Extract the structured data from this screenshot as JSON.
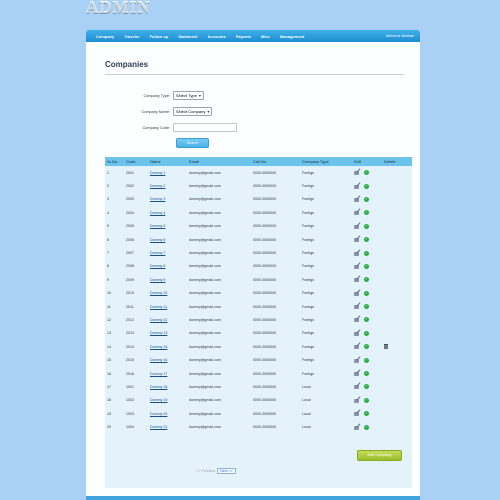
{
  "app": {
    "logo": "ADMIN"
  },
  "nav": {
    "items": [
      "Company",
      "Traveler",
      "Follow up",
      "Statement",
      "Accounts",
      "Reports",
      "Misc",
      "Management"
    ],
    "welcome": "Welcome Bedhan"
  },
  "page": {
    "title": "Companies"
  },
  "form": {
    "company_type_label": "Company Type:",
    "company_type_value": "Select Type",
    "company_name_label": "Company Name:",
    "company_name_value": "Select Company",
    "company_code_label": "Company Code:",
    "company_code_value": "",
    "search_label": "Search"
  },
  "table": {
    "headers": [
      "Sr.No.",
      "Code",
      "Name",
      "Email",
      "Cell No.",
      "Company Type",
      "Edit",
      "Delete"
    ],
    "rows": [
      {
        "sr": "1",
        "code": "2001",
        "name": "Dummy 1",
        "email": "dummy@gmail.com",
        "cell": "0000-0000000",
        "type": "Foreign",
        "delete": false
      },
      {
        "sr": "2",
        "code": "2002",
        "name": "Dummy 2",
        "email": "dummy@gmail.com",
        "cell": "0000-0000000",
        "type": "Foreign",
        "delete": false
      },
      {
        "sr": "3",
        "code": "2003",
        "name": "Dummy 3",
        "email": "dummy@gmail.com",
        "cell": "0000-0000000",
        "type": "Foreign",
        "delete": false
      },
      {
        "sr": "4",
        "code": "2004",
        "name": "Dummy 4",
        "email": "dummy@gmail.com",
        "cell": "0000-0000000",
        "type": "Foreign",
        "delete": false
      },
      {
        "sr": "5",
        "code": "2005",
        "name": "Dummy 5",
        "email": "dummy@gmail.com",
        "cell": "0000-0000000",
        "type": "Foreign",
        "delete": false
      },
      {
        "sr": "6",
        "code": "2006",
        "name": "Dummy 6",
        "email": "dummy@gmail.com",
        "cell": "0000-0000000",
        "type": "Foreign",
        "delete": false
      },
      {
        "sr": "7",
        "code": "2007",
        "name": "Dummy 7",
        "email": "dummy@gmail.com",
        "cell": "0000-0000000",
        "type": "Foreign",
        "delete": false
      },
      {
        "sr": "8",
        "code": "2008",
        "name": "Dummy 8",
        "email": "dummy@gmail.com",
        "cell": "0000-0000000",
        "type": "Foreign",
        "delete": false
      },
      {
        "sr": "9",
        "code": "2009",
        "name": "Dummy 9",
        "email": "dummy@gmail.com",
        "cell": "0000-0000000",
        "type": "Foreign",
        "delete": false
      },
      {
        "sr": "10",
        "code": "2010",
        "name": "Dummy 10",
        "email": "dummy@gmail.com",
        "cell": "0000-0000000",
        "type": "Foreign",
        "delete": false
      },
      {
        "sr": "11",
        "code": "2011",
        "name": "Dummy 11",
        "email": "dummy@gmail.com",
        "cell": "0000-0000000",
        "type": "Foreign",
        "delete": false
      },
      {
        "sr": "12",
        "code": "2012",
        "name": "Dummy 12",
        "email": "dummy@gmail.com",
        "cell": "0000-0000000",
        "type": "Foreign",
        "delete": false
      },
      {
        "sr": "13",
        "code": "2013",
        "name": "Dummy 13",
        "email": "dummy@gmail.com",
        "cell": "0000-0000000",
        "type": "Foreign",
        "delete": false
      },
      {
        "sr": "14",
        "code": "2014",
        "name": "Dummy 15",
        "email": "dummy@gmail.com",
        "cell": "0000-0000000",
        "type": "Foreign",
        "delete": true
      },
      {
        "sr": "15",
        "code": "2015",
        "name": "Dummy 16",
        "email": "dummy@gmail.com",
        "cell": "0000-0000000",
        "type": "Foreign",
        "delete": false
      },
      {
        "sr": "16",
        "code": "2016",
        "name": "Dummy 17",
        "email": "dummy@gmail.com",
        "cell": "0000-0000000",
        "type": "Foreign",
        "delete": false
      },
      {
        "sr": "17",
        "code": "1001",
        "name": "Dummy 18",
        "email": "dummy@gmail.com",
        "cell": "0000-0000000",
        "type": "Local",
        "delete": false
      },
      {
        "sr": "18",
        "code": "1002",
        "name": "Dummy 19",
        "email": "dummy@gmail.com",
        "cell": "0000-0000000",
        "type": "Local",
        "delete": false
      },
      {
        "sr": "19",
        "code": "1003",
        "name": "Dummy 20",
        "email": "dummy@gmail.com",
        "cell": "0000-0000000",
        "type": "Local",
        "delete": false
      },
      {
        "sr": "20",
        "code": "1004",
        "name": "Dummy 21",
        "email": "dummy@gmail.com",
        "cell": "0000-0000000",
        "type": "Local",
        "delete": false
      }
    ]
  },
  "pager": {
    "prev_label": "<< Previous",
    "next_label": "Next >>"
  },
  "actions": {
    "add_company_label": "Add Company"
  },
  "icons": {
    "edit": "pencil-icon",
    "approve": "check-icon",
    "delete": "trash-icon"
  },
  "colors": {
    "nav": "#1d8cd0",
    "header_row": "#6cc3ec",
    "add_button": "#9bbd2c",
    "approve": "#28a745"
  }
}
